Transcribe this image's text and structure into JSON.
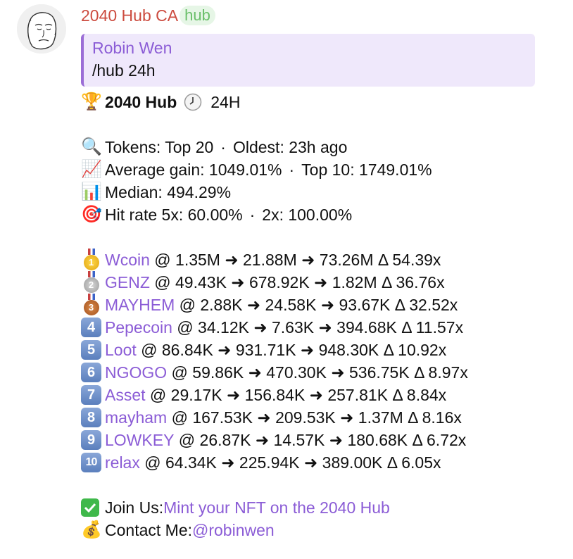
{
  "sender": {
    "name": "2040 Hub CA",
    "badge": "hub"
  },
  "reply": {
    "name": "Robin Wen",
    "text": "/hub 24h"
  },
  "header": {
    "title": "2040 Hub",
    "period": "24H",
    "icons": [
      "trophy-icon",
      "clock-icon"
    ]
  },
  "stats": {
    "tokens": "Tokens: Top 20",
    "oldest": "Oldest: 23h ago",
    "avg": "Average gain: 1049.01%",
    "top10": "Top 10: 1749.01%",
    "median": "Median: 494.29%",
    "hit": "Hit rate 5x: 60.00%",
    "hit2": "2x: 100.00%",
    "sep": "·"
  },
  "arrow": "➜",
  "rank_labels": [
    "1",
    "2",
    "3",
    "4",
    "5",
    "6",
    "7",
    "8",
    "9",
    "10"
  ],
  "tokens": [
    {
      "name": "Wcoin",
      "rest": " @ 1.35M ➜ 21.88M ➜ 73.26M Δ 54.39x"
    },
    {
      "name": "GENZ",
      "rest": " @ 49.43K ➜ 678.92K ➜ 1.82M Δ 36.76x"
    },
    {
      "name": "MAYHEM",
      "rest": " @ 2.88K ➜ 24.58K ➜ 93.67K Δ 32.52x"
    },
    {
      "name": "Pepecoin",
      "rest": " @ 34.12K ➜ 7.63K ➜ 394.68K Δ 11.57x"
    },
    {
      "name": "Loot",
      "rest": " @ 86.84K ➜ 931.71K ➜ 948.30K Δ 10.92x"
    },
    {
      "name": "NGOGO",
      "rest": " @ 59.86K ➜ 470.30K ➜ 536.75K Δ 8.97x"
    },
    {
      "name": "Asset",
      "rest": " @ 29.17K ➜ 156.84K ➜ 257.81K Δ 8.84x"
    },
    {
      "name": "mayham",
      "rest": " @ 167.53K ➜ 209.53K ➜ 1.37M Δ 8.16x"
    },
    {
      "name": "LOWKEY",
      "rest": " @ 26.87K ➜ 14.57K ➜ 180.68K Δ 6.72x"
    },
    {
      "name": "relax",
      "rest": " @ 64.34K ➜ 225.94K ➜ 389.00K Δ 6.05x"
    }
  ],
  "footer": {
    "join_label": "Join Us: ",
    "join_link": "Mint your NFT on the 2040 Hub",
    "contact_label": "Contact Me: ",
    "contact_link": "@robinwen"
  }
}
